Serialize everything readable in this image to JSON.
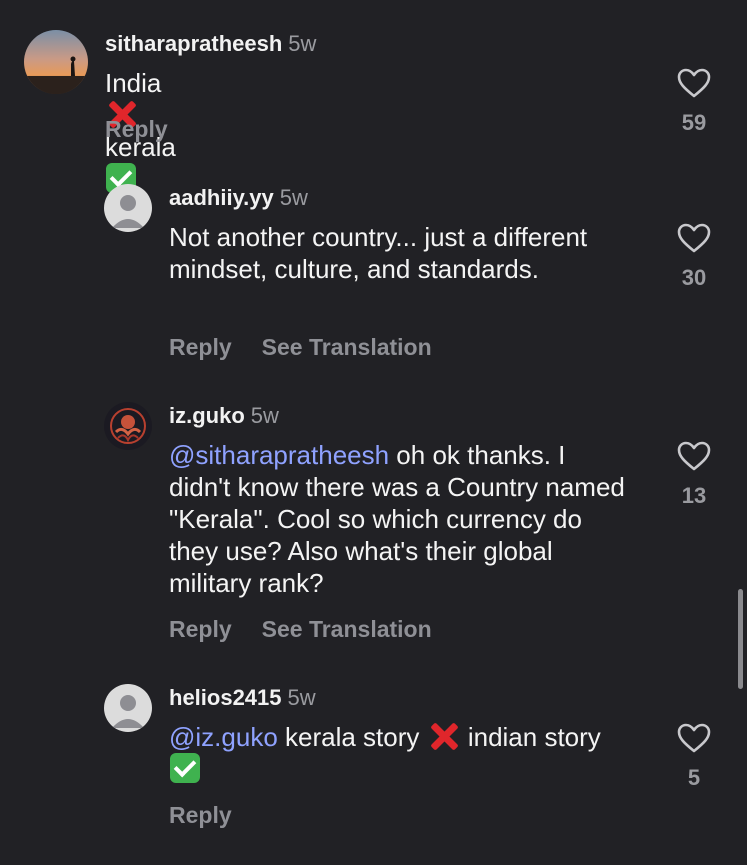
{
  "comments": [
    {
      "username": "sitharapratheesh",
      "time": "5w",
      "text_a": "India",
      "text_b": " kerala",
      "likes": "59",
      "actions": [
        "Reply"
      ]
    },
    {
      "username": "aadhiiy.yy",
      "time": "5w",
      "text": "Not another country... just a different mindset, culture, and standards.",
      "likes": "30",
      "actions": [
        "Reply",
        "See Translation"
      ]
    },
    {
      "username": "iz.guko",
      "time": "5w",
      "mention": "@sitharapratheesh",
      "text": " oh ok thanks. I didn't know there was a Country named \"Kerala\". Cool so which currency do they use? Also what's their global military rank?",
      "likes": "13",
      "actions": [
        "Reply",
        "See Translation"
      ]
    },
    {
      "username": "helios2415",
      "time": "5w",
      "mention": "@iz.guko",
      "text_a": " kerala story ",
      "text_b": " indian story",
      "likes": "5",
      "actions": [
        "Reply"
      ]
    }
  ],
  "colors": {
    "background": "#212125",
    "mention": "#8fa2ff",
    "secondary_text": "#9a9ba0"
  },
  "icons": [
    "heart-outline-icon",
    "cross-mark-emoji",
    "check-mark-emoji",
    "default-avatar-icon"
  ]
}
